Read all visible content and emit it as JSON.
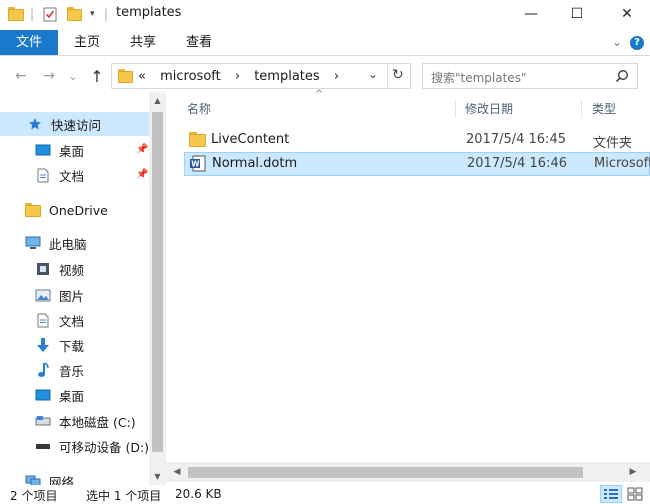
{
  "window": {
    "title": "templates",
    "minimize_glyph": "—",
    "maximize_glyph": "☐",
    "close_glyph": "✕"
  },
  "ribbon": {
    "tabs": [
      "文件",
      "主页",
      "共享",
      "查看"
    ],
    "expand_glyph": "⌄",
    "help_glyph": "?"
  },
  "nav": {
    "back_glyph": "←",
    "forward_glyph": "→",
    "recent_glyph": "⌄",
    "up_glyph": "↑",
    "breadcrumb_prefix": "«",
    "breadcrumbs": [
      "microsoft",
      "templates"
    ],
    "separator": "›",
    "dropdown_glyph": "⌄",
    "refresh_glyph": "↻"
  },
  "search": {
    "placeholder": "搜索\"templates\"",
    "icon": "search-icon"
  },
  "sidebar": {
    "items": [
      {
        "label": "快速访问",
        "icon": "star-icon"
      },
      {
        "label": "桌面",
        "icon": "desktop-icon",
        "pinned": true
      },
      {
        "label": "文档",
        "icon": "document-icon",
        "pinned": true
      },
      {
        "label": "OneDrive",
        "icon": "folder-icon"
      },
      {
        "label": "此电脑",
        "icon": "computer-icon"
      },
      {
        "label": "视频",
        "icon": "video-icon"
      },
      {
        "label": "图片",
        "icon": "picture-icon"
      },
      {
        "label": "文档",
        "icon": "document-icon"
      },
      {
        "label": "下载",
        "icon": "download-icon"
      },
      {
        "label": "音乐",
        "icon": "music-icon"
      },
      {
        "label": "桌面",
        "icon": "desktop-icon"
      },
      {
        "label": "本地磁盘 (C:)",
        "icon": "drive-icon"
      },
      {
        "label": "可移动设备 (D:)",
        "icon": "usb-drive-icon"
      },
      {
        "label": "网络",
        "icon": "network-icon"
      }
    ]
  },
  "files": {
    "columns": {
      "name": "名称",
      "modified": "修改日期",
      "type": "类型"
    },
    "sort_glyph": "^",
    "rows": [
      {
        "name": "LiveContent",
        "modified": "2017/5/4 16:45",
        "type": "文件夹",
        "icon": "folder-icon"
      },
      {
        "name": "Normal.dotm",
        "modified": "2017/5/4 16:46",
        "type": "Microsoft",
        "icon": "word-template-icon"
      }
    ]
  },
  "status": {
    "item_count": "2 个项目",
    "selected": "选中 1 个项目",
    "size": "20.6 KB"
  },
  "colors": {
    "accent": "#1979ca",
    "selection": "#cce8ff",
    "selection_border": "#99d1ff",
    "folder": "#f5c84c"
  }
}
